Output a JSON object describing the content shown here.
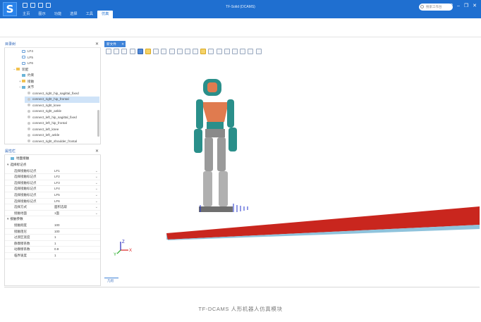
{
  "app": {
    "title": "TF-Solid (DCAMS)",
    "logo_letter": "S",
    "menu_tabs": [
      "主页",
      "图示",
      "功能",
      "选择",
      "工具",
      "仿真"
    ],
    "active_tab_index": 5,
    "search_placeholder": "搜索工作台",
    "window_controls": {
      "help": "?",
      "minimize": "–",
      "restore": "❐",
      "close": "✕"
    },
    "accent_color": "#1f6fd0"
  },
  "tree_panel": {
    "title": "目录树",
    "close": "✕",
    "items": [
      {
        "label": "LF4",
        "icon": "frame-icon",
        "indent": 2
      },
      {
        "label": "LF5",
        "icon": "frame-icon",
        "indent": 2
      },
      {
        "label": "LF6",
        "icon": "frame-icon",
        "indent": 2
      },
      {
        "label": "装配",
        "icon": "folder-icon",
        "indent": 1,
        "twist": "−"
      },
      {
        "label": "约束",
        "icon": "constraint-icon",
        "indent": 2
      },
      {
        "label": "接触",
        "icon": "contact-icon",
        "indent": 2,
        "twist": "+"
      },
      {
        "label": "关节",
        "icon": "hinge-icon",
        "indent": 2,
        "twist": "−"
      },
      {
        "label": "connect_right_hip_sagittal_fixed",
        "icon": "joint-icon",
        "indent": 3
      },
      {
        "label": "connect_right_hip_frontal",
        "icon": "joint-icon",
        "indent": 3,
        "selected": true
      },
      {
        "label": "connect_right_knee",
        "icon": "joint-icon",
        "indent": 3
      },
      {
        "label": "connect_right_ankle",
        "icon": "joint-icon",
        "indent": 3
      },
      {
        "label": "connect_left_hip_sagittal_fixed",
        "icon": "joint-icon",
        "indent": 3
      },
      {
        "label": "connect_left_hip_frontal",
        "icon": "joint-icon",
        "indent": 3
      },
      {
        "label": "connect_left_knee",
        "icon": "joint-icon",
        "indent": 3
      },
      {
        "label": "connect_left_ankle",
        "icon": "joint-icon",
        "indent": 3
      },
      {
        "label": "connect_right_shoulder_frontal",
        "icon": "joint-icon",
        "indent": 3
      }
    ]
  },
  "property_panel": {
    "title": "属性栏",
    "close": "✕",
    "header_item": "地面接触",
    "sections": [
      {
        "label": "选择标记点",
        "rows": [
          {
            "label": "选择接触标记点",
            "value": "LF1"
          },
          {
            "label": "选择接触标记点",
            "value": "LF2"
          },
          {
            "label": "选择接触标记点",
            "value": "LF3"
          },
          {
            "label": "选择接触标记点",
            "value": "LF4"
          },
          {
            "label": "选择接触标记点",
            "value": "LF5"
          },
          {
            "label": "选择接触标记点",
            "value": "LF6"
          },
          {
            "label": "选择方式",
            "value": "面积选取"
          },
          {
            "label": "接触地面",
            "value": "1面"
          }
        ]
      },
      {
        "label": "接触参数",
        "rows": [
          {
            "label": "接触刚度",
            "value": "100"
          },
          {
            "label": "接触阻尼",
            "value": "100"
          },
          {
            "label": "过渡区宽度",
            "value": "1"
          },
          {
            "label": "静摩擦系数",
            "value": "1"
          },
          {
            "label": "动摩擦系数",
            "value": "0.9"
          },
          {
            "label": "临界速度",
            "value": "1"
          }
        ]
      }
    ]
  },
  "viewport": {
    "tab_label": "新文件",
    "tab_close": "✕",
    "bottom_tab": "几何",
    "axis_labels": {
      "x": "X",
      "y": "Y",
      "z": "Z"
    },
    "toolbar_icons": [
      "rect-select-icon",
      "add-frame-icon",
      "add-frame-2-icon",
      "add-frame-3-icon",
      "cube-icon",
      "highlight-icon",
      "window-icon",
      "corner-icon",
      "view-front-icon",
      "view-side-icon",
      "view-top-icon",
      "view-iso-icon",
      "zoom-icon",
      "zoom-fit-icon",
      "grid-icon",
      "measure-icon",
      "copy-icon",
      "paste-icon",
      "layers-icon",
      "clear-icon"
    ],
    "floor_color": "#c9261e",
    "floor_edge_color": "#8fc3dc",
    "robot_color": "#2a8f8a",
    "robot_accent": "#e07b4f"
  },
  "caption": "TF-DCAMS 人形机器人仿真模块"
}
